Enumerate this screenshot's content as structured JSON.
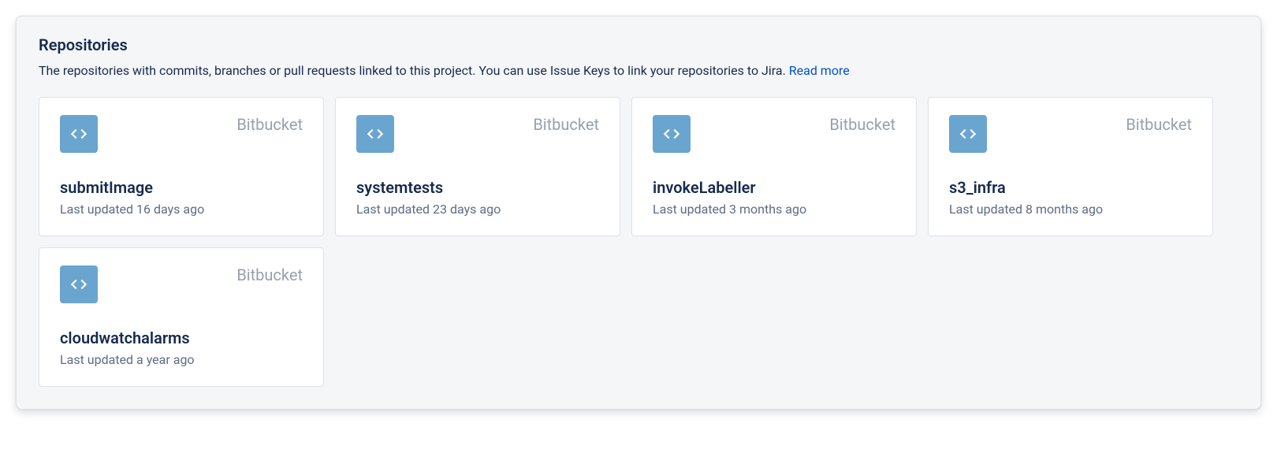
{
  "header": {
    "title": "Repositories",
    "subtitle": "The repositories with commits, branches or pull requests linked to this project. You can use Issue Keys to link your repositories to Jira. ",
    "read_more": "Read more"
  },
  "repositories": [
    {
      "name": "submitImage",
      "provider": "Bitbucket",
      "updated": "Last updated 16 days ago"
    },
    {
      "name": "systemtests",
      "provider": "Bitbucket",
      "updated": "Last updated 23 days ago"
    },
    {
      "name": "invokeLabeller",
      "provider": "Bitbucket",
      "updated": "Last updated 3 months ago"
    },
    {
      "name": "s3_infra",
      "provider": "Bitbucket",
      "updated": "Last updated 8 months ago"
    },
    {
      "name": "cloudwatchalarms",
      "provider": "Bitbucket",
      "updated": "Last updated a year ago"
    }
  ]
}
